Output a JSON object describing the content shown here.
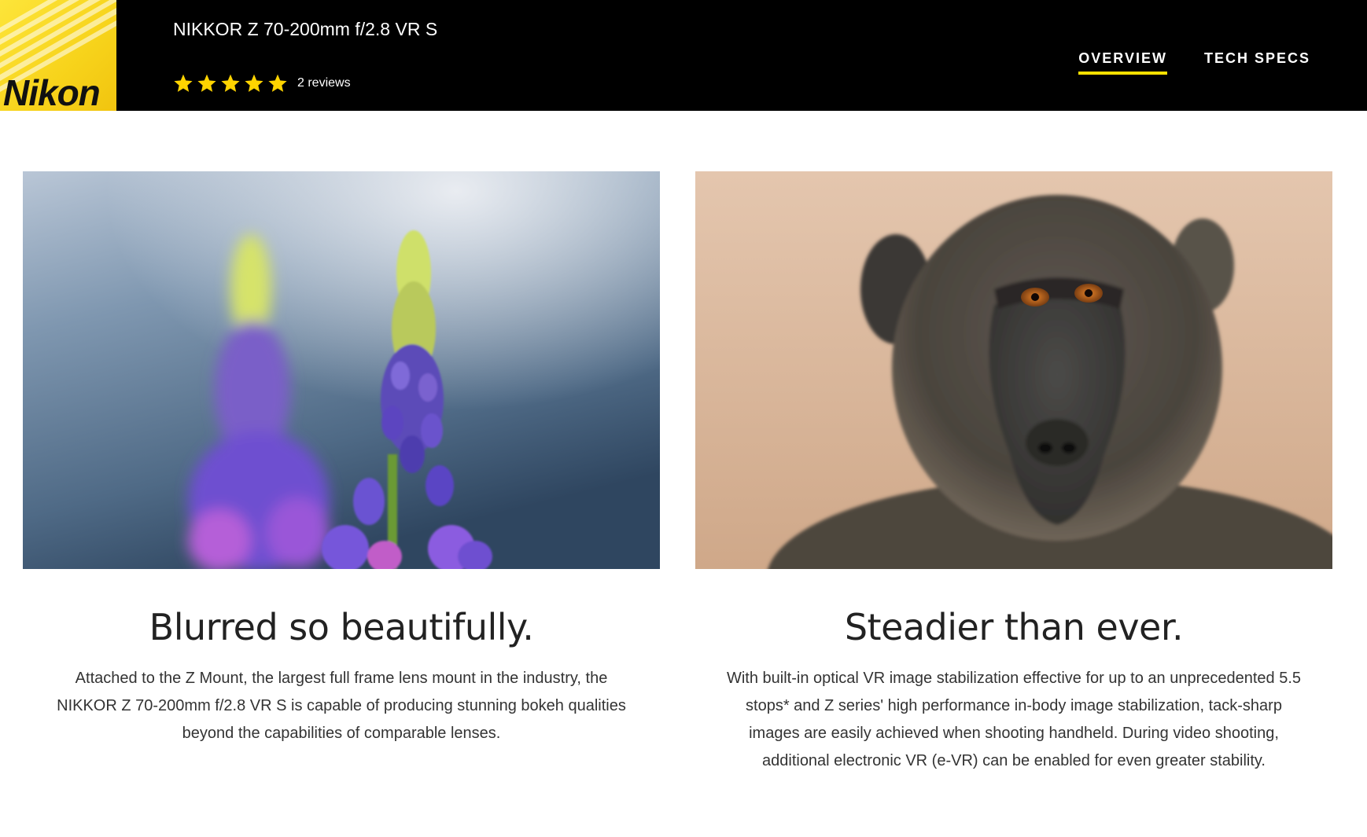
{
  "brand": {
    "logo_text": "Nikon",
    "colors": {
      "header_bg": "#000000",
      "accent": "#ffe100",
      "star": "#ffd400"
    }
  },
  "product": {
    "title": "NIKKOR Z 70-200mm f/2.8 VR S",
    "rating": {
      "stars": 5,
      "max_stars": 5,
      "reviews_label": "2 reviews"
    }
  },
  "nav": {
    "tabs": [
      {
        "label": "OVERVIEW",
        "active": true
      },
      {
        "label": "TECH SPECS",
        "active": false
      }
    ]
  },
  "features": [
    {
      "image": "lupine-flowers-bokeh-photo",
      "heading": "Blurred so beautifully.",
      "body": "Attached to the Z Mount, the largest full frame lens mount in the industry, the NIKKOR Z 70-200mm f/2.8 VR S is capable of producing stunning bokeh qualities beyond the capabilities of comparable lenses."
    },
    {
      "image": "baboon-portrait-photo",
      "heading": "Steadier than ever.",
      "body": "With built-in optical VR image stabilization effective for up to an unprecedented 5.5 stops* and Z series' high performance in-body image stabilization, tack-sharp images are easily achieved when shooting handheld. During video shooting, additional electronic VR (e-VR) can be enabled for even greater stability."
    }
  ]
}
